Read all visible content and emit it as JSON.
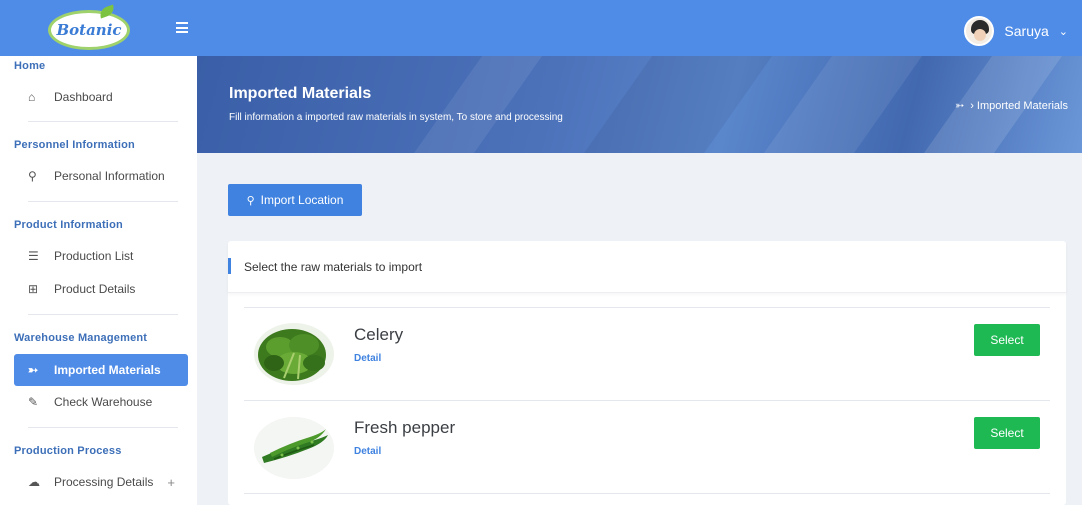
{
  "app": {
    "logo_text": "Botanic",
    "user_name": "Saruya"
  },
  "sidebar": {
    "sections": [
      {
        "title": "Home",
        "items": [
          {
            "label": "Dashboard",
            "icon": "home-icon"
          }
        ]
      },
      {
        "title": "Personnel Information",
        "items": [
          {
            "label": "Personal Information",
            "icon": "user-icon"
          }
        ]
      },
      {
        "title": "Product Information",
        "items": [
          {
            "label": "Production List",
            "icon": "list-icon"
          },
          {
            "label": "Product Details",
            "icon": "grid-icon"
          }
        ]
      },
      {
        "title": "Warehouse Management",
        "items": [
          {
            "label": "Imported Materials",
            "icon": "import-icon",
            "active": true
          },
          {
            "label": "Check Warehouse",
            "icon": "edit-icon"
          }
        ]
      },
      {
        "title": "Production Process",
        "items": [
          {
            "label": "Processing Details",
            "icon": "cloud-icon",
            "expand": "+"
          }
        ]
      }
    ]
  },
  "header": {
    "title": "Imported Materials",
    "subtitle": "Fill information a imported raw materials in system, To store and processing",
    "breadcrumb": "› Imported Materials"
  },
  "import_button": {
    "label": "Import Location"
  },
  "card": {
    "title": "Select the raw materials to import",
    "items": [
      {
        "name": "Celery",
        "detail_label": "Detail",
        "select_label": "Select"
      },
      {
        "name": "Fresh pepper",
        "detail_label": "Detail",
        "select_label": "Select"
      }
    ]
  },
  "colors": {
    "primary": "#4f8ce8",
    "select": "#1fb954",
    "section_title": "#3d6fb8"
  }
}
